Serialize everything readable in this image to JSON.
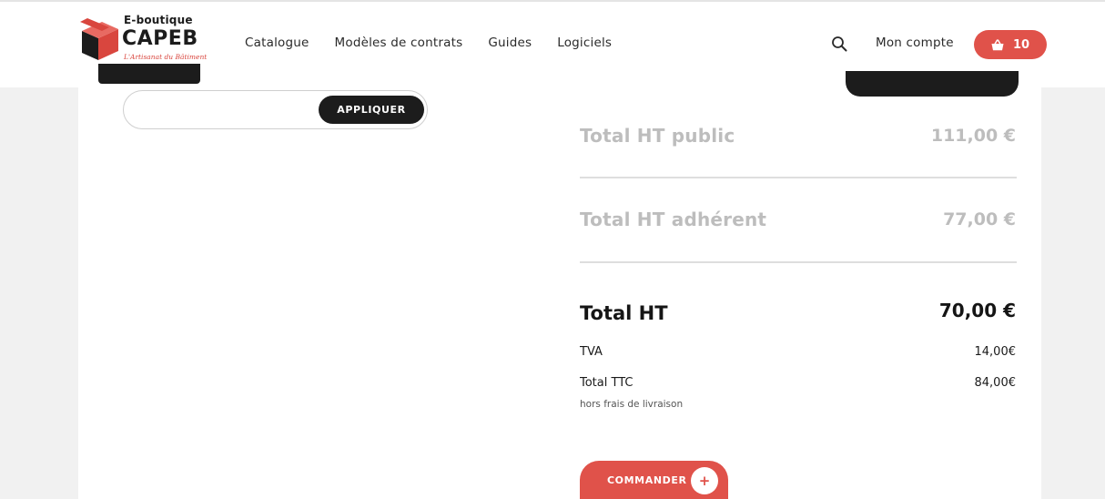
{
  "header": {
    "logo": {
      "line1": "E-boutique",
      "line2": "CAPEB",
      "tagline": "L'Artisanat du Bâtiment"
    },
    "nav": [
      {
        "label": "Catalogue"
      },
      {
        "label": "Modèles de contrats"
      },
      {
        "label": "Guides"
      },
      {
        "label": "Logiciels"
      }
    ],
    "account_label": "Mon compte",
    "cart_count": "10"
  },
  "promo": {
    "code_value": "",
    "apply_label": "APPLIQUER"
  },
  "summary": {
    "public_label": "Total HT public",
    "public_value": "111,00 €",
    "member_label": "Total HT adhérent",
    "member_value": "77,00 €",
    "total_ht_label": "Total HT",
    "total_ht_value": "70,00 €",
    "tva_label": "TVA",
    "tva_value": "14,00€",
    "ttc_label": "Total TTC",
    "ttc_value": "84,00€",
    "shipping_note": "hors frais de livraison"
  },
  "order": {
    "label": "COMMANDER",
    "plus": "+"
  },
  "colors": {
    "accent": "#e0524a",
    "dark": "#1c1c1c",
    "muted": "#bdbdbd"
  }
}
